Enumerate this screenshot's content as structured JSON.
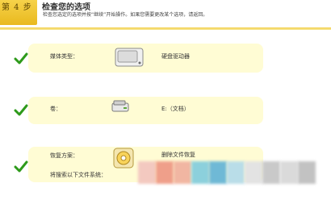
{
  "header": {
    "step_label": "第 4 步",
    "title": "检查您的选项",
    "subtitle": "检查您选定的选项并按“继续”开始操作。如果您需要更改某个选项，请返回。"
  },
  "cards": [
    {
      "label": "媒体类型：",
      "value": "硬盘驱动器",
      "icon": "hard-drive-icon"
    },
    {
      "label": "卷：",
      "value": "E:（文档）",
      "icon": "drive-volume-icon"
    },
    {
      "label": "恢复方案：",
      "value": "删除文件恢复",
      "icon": "recovery-icon",
      "extra_label": "将搜索以下文件系统："
    }
  ],
  "colors": {
    "header_tab": "#e9b91e",
    "card_bg": "#fffcd4",
    "check": "#2e9a1b"
  }
}
